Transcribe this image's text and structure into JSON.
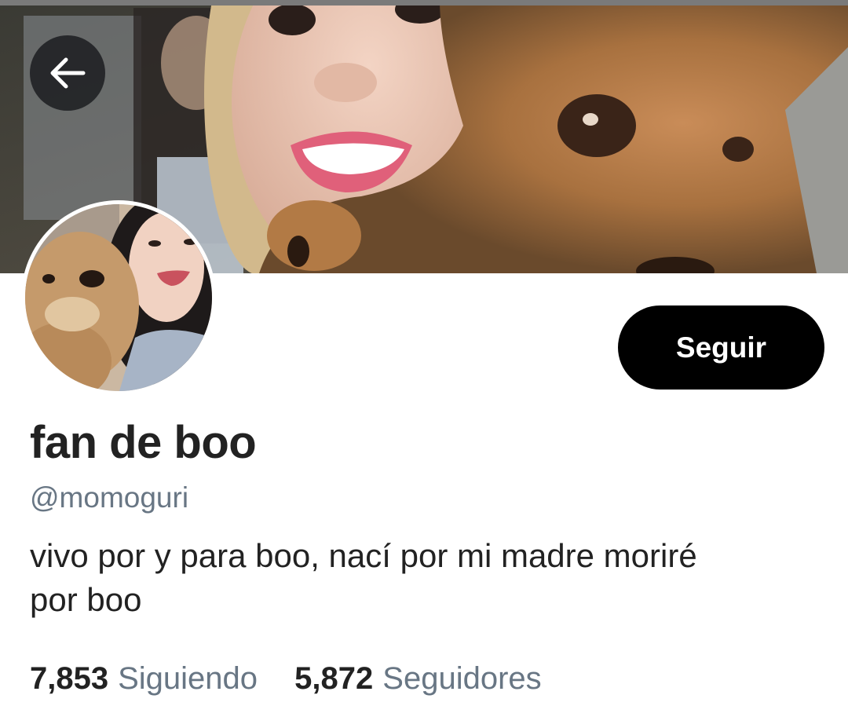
{
  "header": {
    "back_icon": "arrow-left-icon"
  },
  "profile": {
    "display_name": "fan de boo",
    "handle": "@momoguri",
    "bio_line1": "vivo por y para boo, nací por mi madre moriré",
    "bio_line2": "por boo",
    "follow_label": "Seguir"
  },
  "stats": {
    "following_count": "7,853",
    "following_label": "Siguiendo",
    "followers_count": "5,872",
    "followers_label": "Seguidores"
  },
  "colors": {
    "follow_bg": "#000000",
    "secondary_text": "#687684",
    "primary_text": "#222222"
  }
}
